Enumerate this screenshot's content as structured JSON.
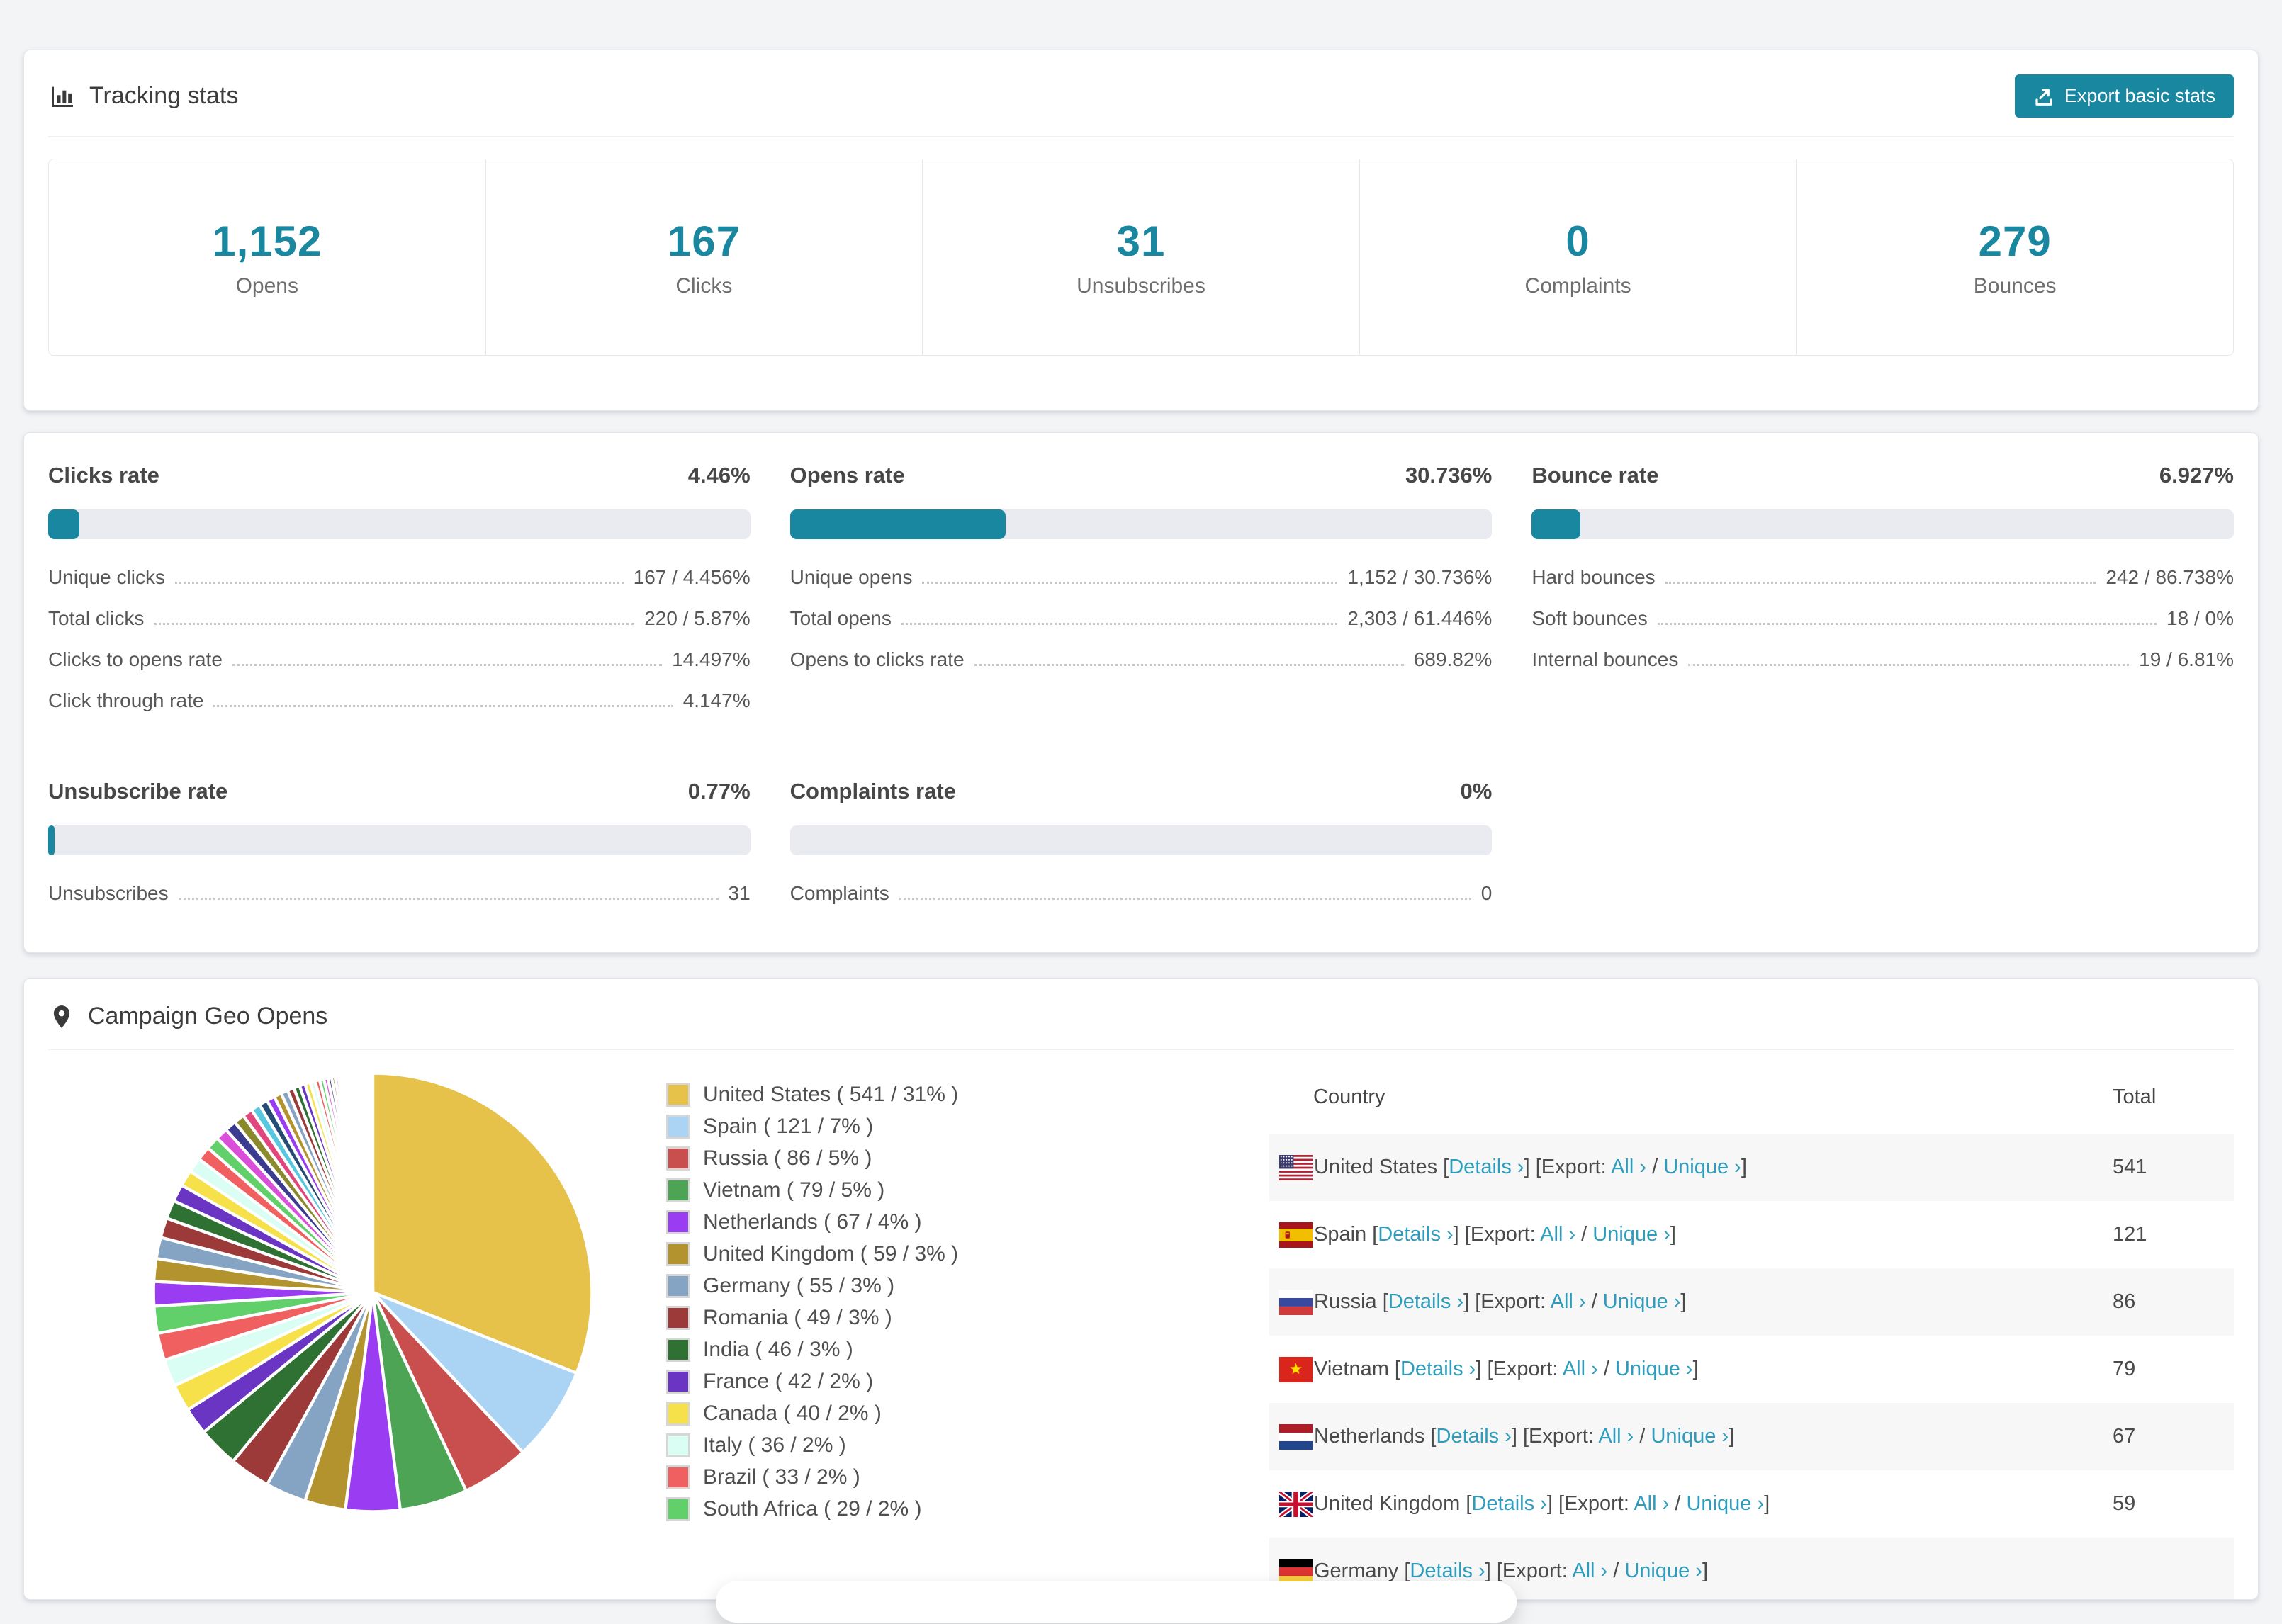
{
  "colors": {
    "accent": "#1a87a0",
    "link": "#2e9dbd",
    "page_bg": "#f3f4f6",
    "bar_track": "#e9ebf0",
    "row_stripe": "#f7f7f8"
  },
  "tracking_stats": {
    "title": "Tracking stats",
    "export_button": "Export basic stats",
    "stats": [
      {
        "value": "1,152",
        "label": "Opens"
      },
      {
        "value": "167",
        "label": "Clicks"
      },
      {
        "value": "31",
        "label": "Unsubscribes"
      },
      {
        "value": "0",
        "label": "Complaints"
      },
      {
        "value": "279",
        "label": "Bounces"
      }
    ]
  },
  "rates": {
    "panels": [
      {
        "title": "Clicks rate",
        "value": "4.46%",
        "pct": 4.46,
        "rows": [
          {
            "label": "Unique clicks",
            "value": "167 / 4.456%"
          },
          {
            "label": "Total clicks",
            "value": "220 / 5.87%"
          },
          {
            "label": "Clicks to opens rate",
            "value": "14.497%"
          },
          {
            "label": "Click through rate",
            "value": "4.147%"
          }
        ]
      },
      {
        "title": "Opens rate",
        "value": "30.736%",
        "pct": 30.736,
        "rows": [
          {
            "label": "Unique opens",
            "value": "1,152 / 30.736%"
          },
          {
            "label": "Total opens",
            "value": "2,303 / 61.446%"
          },
          {
            "label": "Opens to clicks rate",
            "value": "689.82%"
          }
        ]
      },
      {
        "title": "Bounce rate",
        "value": "6.927%",
        "pct": 6.927,
        "rows": [
          {
            "label": "Hard bounces",
            "value": "242 / 86.738%"
          },
          {
            "label": "Soft bounces",
            "value": "18 / 0%"
          },
          {
            "label": "Internal bounces",
            "value": "19 / 6.81%"
          }
        ]
      },
      {
        "title": "Unsubscribe rate",
        "value": "0.77%",
        "pct": 0.77,
        "rows": [
          {
            "label": "Unsubscribes",
            "value": "31"
          }
        ]
      },
      {
        "title": "Complaints rate",
        "value": "0%",
        "pct": 0,
        "rows": [
          {
            "label": "Complaints",
            "value": "0"
          }
        ]
      }
    ]
  },
  "geo": {
    "title": "Campaign Geo Opens",
    "table": {
      "headers": [
        "Country",
        "Total"
      ],
      "link_details": "Details",
      "export_prefix": "Export:",
      "link_all": "All",
      "link_unique": "Unique",
      "chevron": "›",
      "rows": [
        {
          "flag": "us",
          "country": "United States",
          "total": "541"
        },
        {
          "flag": "es",
          "country": "Spain",
          "total": "121"
        },
        {
          "flag": "ru",
          "country": "Russia",
          "total": "86"
        },
        {
          "flag": "vn",
          "country": "Vietnam",
          "total": "79"
        },
        {
          "flag": "nl",
          "country": "Netherlands",
          "total": "67"
        },
        {
          "flag": "gb",
          "country": "United Kingdom",
          "total": "59"
        },
        {
          "flag": "de",
          "country": "Germany",
          "total": "",
          "partial": true
        }
      ]
    }
  },
  "chart_data": {
    "type": "pie",
    "title": "Campaign Geo Opens",
    "start_angle_deg": -90,
    "direction": "clockwise",
    "legend_position": "right-of-pie",
    "series": [
      {
        "name": "United States",
        "value": 541,
        "pct": 31,
        "color": "#e6c24a"
      },
      {
        "name": "Spain",
        "value": 121,
        "pct": 7,
        "color": "#abd4f4"
      },
      {
        "name": "Russia",
        "value": 86,
        "pct": 5,
        "color": "#c94f4f"
      },
      {
        "name": "Vietnam",
        "value": 79,
        "pct": 5,
        "color": "#4ea455"
      },
      {
        "name": "Netherlands",
        "value": 67,
        "pct": 4,
        "color": "#9a3df2"
      },
      {
        "name": "United Kingdom",
        "value": 59,
        "pct": 3,
        "color": "#b3932e"
      },
      {
        "name": "Germany",
        "value": 55,
        "pct": 3,
        "color": "#85a3c2"
      },
      {
        "name": "Romania",
        "value": 49,
        "pct": 3,
        "color": "#9c3a3a"
      },
      {
        "name": "India",
        "value": 46,
        "pct": 3,
        "color": "#2f7033"
      },
      {
        "name": "France",
        "value": 42,
        "pct": 2,
        "color": "#6a35c2"
      },
      {
        "name": "Canada",
        "value": 40,
        "pct": 2,
        "color": "#f6e14b"
      },
      {
        "name": "Italy",
        "value": 36,
        "pct": 2,
        "color": "#dafdf4"
      },
      {
        "name": "Brazil",
        "value": 33,
        "pct": 2,
        "color": "#f16060"
      },
      {
        "name": "South Africa",
        "value": 29,
        "pct": 2,
        "color": "#62d06a"
      }
    ],
    "unlabeled_small_slices_total_pct": 26
  }
}
